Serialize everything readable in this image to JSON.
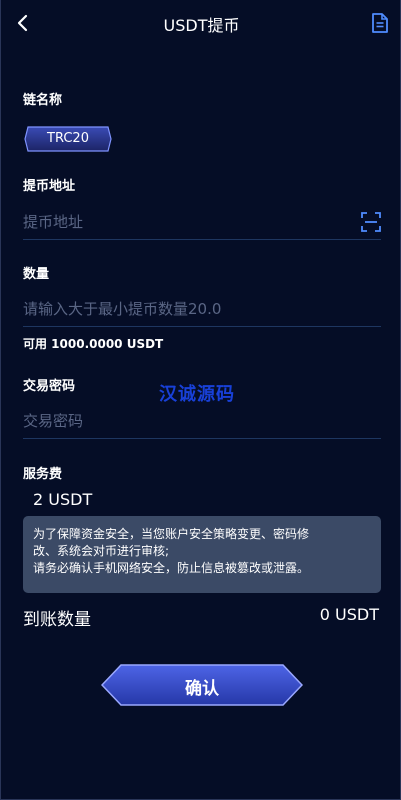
{
  "header": {
    "title": "USDT提币",
    "back_icon": "chevron-left-icon",
    "right_icon": "document-icon"
  },
  "chain": {
    "label": "链名称",
    "selected": "TRC20"
  },
  "address": {
    "label": "提币地址",
    "placeholder": "提币地址",
    "value": "",
    "scan_icon": "scan-icon"
  },
  "amount": {
    "label": "数量",
    "placeholder": "请输入大于最小提币数量20.0",
    "value": "",
    "available": "可用 1000.0000 USDT"
  },
  "password": {
    "label": "交易密码",
    "placeholder": "交易密码",
    "value": ""
  },
  "watermark": "汉诚源码",
  "fee": {
    "label": "服务费",
    "value": "2 USDT"
  },
  "notice": {
    "lines": [
      "为了保障资金安全，当您账户安全策略变更、密码修",
      "改、系统会对币进行审核;",
      "请务必确认手机网络安全，防止信息被篡改或泄露。"
    ]
  },
  "arrival": {
    "label": "到账数量",
    "value": "0 USDT"
  },
  "confirm_label": "确认",
  "colors": {
    "background": "#050d26",
    "accent": "#3d55d6",
    "notice_bg": "#3b4a66",
    "watermark": "#1840d8"
  }
}
